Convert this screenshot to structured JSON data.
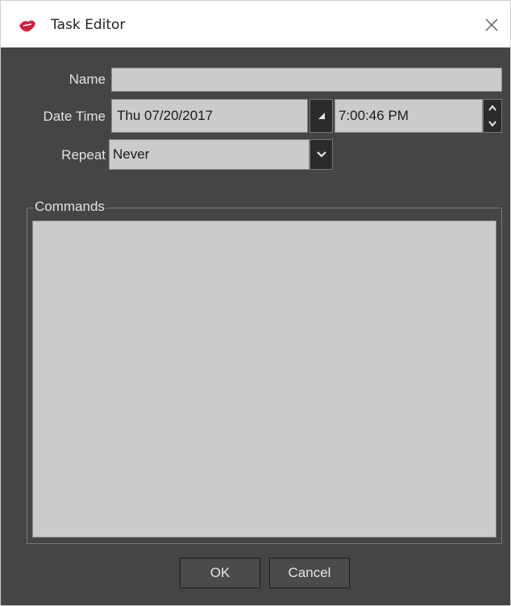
{
  "window": {
    "title": "Task Editor",
    "close_glyph": "✕"
  },
  "form": {
    "name_label": "Name",
    "name_value": "",
    "datetime_label": "Date Time",
    "date_value": "Thu 07/20/2017",
    "time_value": "7:00:46 PM",
    "repeat_label": "Repeat",
    "repeat_value": "Never"
  },
  "commands": {
    "group_label": "Commands"
  },
  "buttons": {
    "ok_label": "OK",
    "cancel_label": "Cancel"
  },
  "icons": {
    "app": "app-logo-icon",
    "date_picker": "calendar-dropdown-icon",
    "spin_up": "chevron-up-icon",
    "spin_down": "chevron-down-icon",
    "repeat_dropdown": "chevron-down-icon",
    "close": "close-icon"
  },
  "colors": {
    "panel_bg": "#454545",
    "field_bg": "#cbcbcb",
    "button_dark": "#2b2b2b",
    "label_text": "#e2e2e2"
  }
}
